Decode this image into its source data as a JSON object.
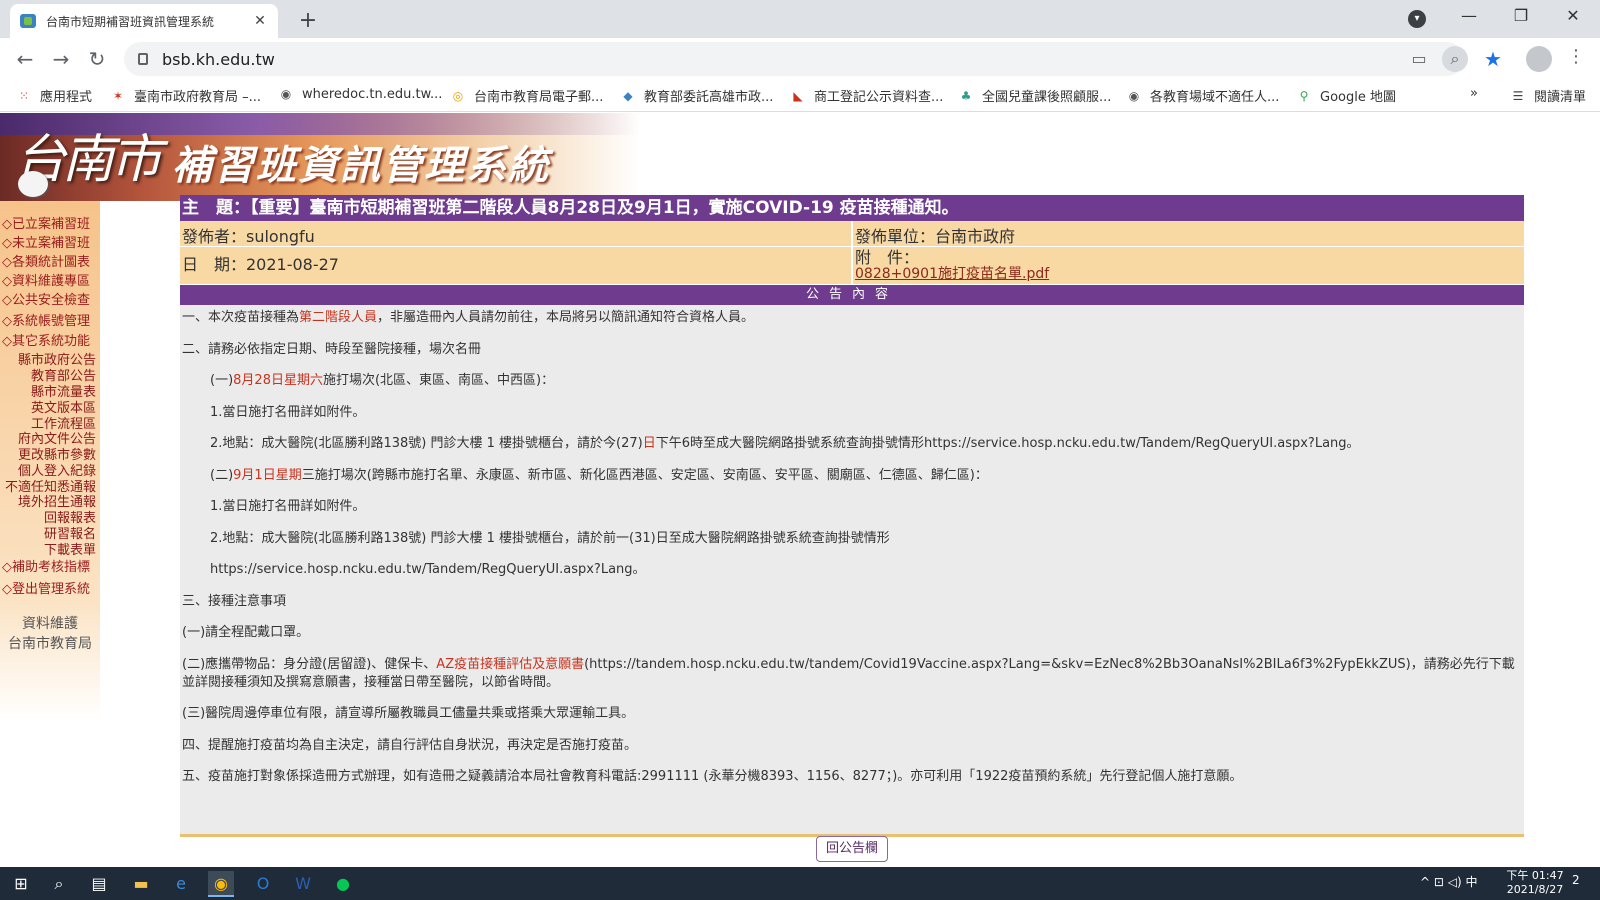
{
  "browser": {
    "tab_title": "台南市短期補習班資訊管理系統",
    "close_glyph": "✕",
    "new_tab_glyph": "+",
    "url": "bsb.kh.edu.tw",
    "window_controls": [
      "—",
      "❐",
      "✕"
    ],
    "icons": {
      "back": "arrow-left-icon",
      "forward": "arrow-right-icon",
      "reload": "reload-icon"
    }
  },
  "bookmarks": [
    {
      "label": "應用程式",
      "color": "#e8453c"
    },
    {
      "label": "臺南市政府教育局 –...",
      "color": "#c8331e"
    },
    {
      "label": "wheredoc.tn.edu.tw...",
      "color": "#555555"
    },
    {
      "label": "台南市教育局電子郵...",
      "color": "#e8a000"
    },
    {
      "label": "教育部委託高雄市政...",
      "color": "#3b82c4"
    },
    {
      "label": "商工登記公示資料查...",
      "color": "#c8331e"
    },
    {
      "label": "全國兒童課後照顧服...",
      "color": "#2a9d8f"
    },
    {
      "label": "各教育場域不適任人...",
      "color": "#555555"
    },
    {
      "label": "Google 地圖",
      "color": "#34a853"
    }
  ],
  "bookmarks_more": "»",
  "reading_list": "閱讀清單",
  "banner": {
    "city": "台南市",
    "system": "補習班資訊管理系統"
  },
  "sidebar": {
    "main_items": [
      "◇已立案補習班",
      "◇未立案補習班",
      "◇各類統計圖表",
      "◇資料維護專區",
      "◇公共安全檢查",
      "◇系統帳號管理",
      "◇其它系統功能"
    ],
    "sub_items": [
      "縣市政府公告",
      "教育部公告",
      "縣市流量表",
      "英文版本區",
      "工作流程區",
      "府內文件公告",
      "更改縣市參數",
      "個人登入紀錄",
      "不適任知悉通報",
      "境外招生通報",
      "回報報表",
      "研習報名",
      "下載表單"
    ],
    "bottom_items": [
      "◇補助考核指標",
      "◇登出管理系統"
    ],
    "footer_title": "資料維護",
    "footer_org": "台南市教育局"
  },
  "announcement": {
    "subject": "主　題：【重要】臺南市短期補習班第二階段人員8月28日及9月1日，實施COVID-19 疫苗接種通知。",
    "publisher": "發佈者：sulongfu",
    "unit": "發佈單位：台南市政府",
    "date": "日　期：2021-08-27",
    "attach_label": "附　件：",
    "attach_file": "0828+0901施打疫苗名單.pdf",
    "section_title": "公告內容",
    "p1_a": "一、本次疫苗接種為",
    "p1_red": "第二階段人員",
    "p1_b": "，非屬造冊內人員請勿前往，本局將另以簡訊通知符合資格人員。",
    "p2": "二、請務必依指定日期、時段至醫院接種，場次名冊",
    "p3_a": "(一)",
    "p3_red": "8月28日星期六",
    "p3_b": "施打場次(北區、東區、南區、中西區)：",
    "p4": "1.當日施打名冊詳如附件。",
    "p5_a": "2.地點：成大醫院(北區勝利路138號) 門診大樓 1 樓掛號櫃台，請於今(27)",
    "p5_red": "日",
    "p5_b": "下午6時至成大醫院網路掛號系統查詢掛號情形https://service.hosp.ncku.edu.tw/Tandem/RegQueryUI.aspx?Lang。",
    "p6_a": "(二)",
    "p6_red": "9月1日星期",
    "p6_b": "三施打場次(跨縣市施打名單、永康區、新市區、新化區西港區、安定區、安南區、安平區、關廟區、仁德區、歸仁區)：",
    "p7": "1.當日施打名冊詳如附件。",
    "p8": "2.地點：成大醫院(北區勝利路138號) 門診大樓 1 樓掛號櫃台，請於前一(31)日至成大醫院網路掛號系統查詢掛號情形",
    "p9": "https://service.hosp.ncku.edu.tw/Tandem/RegQueryUI.aspx?Lang。",
    "p10": "三、接種注意事項",
    "p11": "(一)請全程配戴口罩。",
    "p12_a": "(二)應攜帶物品：身分證(居留證)、健保卡、",
    "p12_red": "AZ疫苗接種評估及意願書",
    "p12_b": "(https://tandem.hosp.ncku.edu.tw/tandem/Covid19Vaccine.aspx?Lang=&skv=EzNec8%2Bb3OanaNsI%2BILa6f3%2FypEkkZUS)，請務必先行下載並詳閱接種須知及撰寫意願書，接種當日帶至醫院，以節省時間。",
    "p13": "(三)醫院周邊停車位有限，請宣導所屬教職員工儘量共乘或搭乘大眾運輸工具。",
    "p14": "四、提醒施打疫苗均為自主決定，請自行評估自身狀況，再決定是否施打疫苗。",
    "p15": "五、疫苗施打對象係採造冊方式辦理，如有造冊之疑義請洽本局社會教育科電話:2991111 (永華分機8393、1156、8277；)。亦可利用「1922疫苗預約系統」先行登記個人施打意願。",
    "back_button": "回公告欄"
  },
  "taskbar": {
    "tray_text": "^  ⊡  ◁)  中",
    "time": "下午 01:47",
    "date": "2021/8/27",
    "notif": "2"
  }
}
